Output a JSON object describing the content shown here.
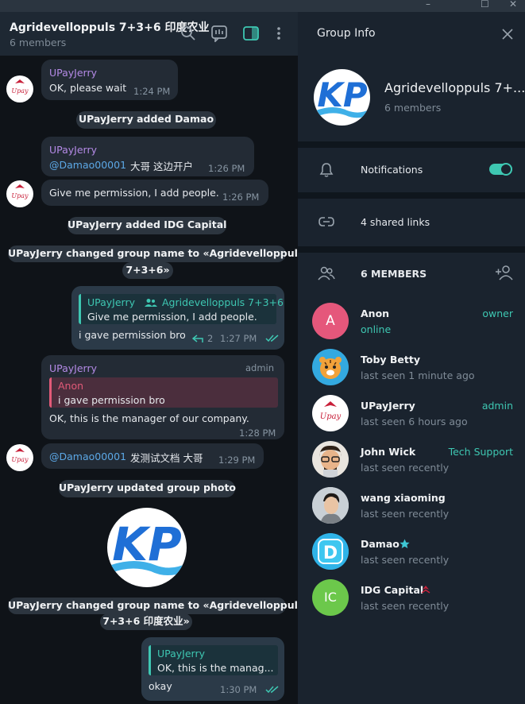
{
  "window": {
    "minimize": "–",
    "maximize": "☐",
    "close": "✕"
  },
  "chat": {
    "title": "Agridevelloppuls 7+3+6 印度农业",
    "subtitle": "6 members",
    "header_icons": [
      "search-icon",
      "poll-icon",
      "sidebar-toggle-icon",
      "more-icon"
    ],
    "messages": {
      "m1": {
        "sender": "UPayJerry",
        "text": "OK, please wait",
        "time": "1:24 PM"
      },
      "s1": "UPayJerry added Damao",
      "m2": {
        "sender": "UPayJerry",
        "mention": "@Damao00001",
        "text": "大哥  这边开户",
        "time": "1:26 PM"
      },
      "m3": {
        "text": "Give me permission, I add people.",
        "time": "1:26 PM"
      },
      "s2": "UPayJerry added IDG Capital",
      "s3_line1": "UPayJerry changed group name to «Agridevelloppuls",
      "s3_line2": "7+3+6»",
      "m4": {
        "reply_sender": "UPayJerry",
        "reply_group": "Agridevelloppuls 7+3+6",
        "reply_text": "Give me permission, I add people.",
        "text": "i gave permission bro",
        "replies": "2",
        "time": "1:27 PM"
      },
      "m5": {
        "sender": "UPayJerry",
        "badge": "admin",
        "reply_sender": "Anon",
        "reply_text": "i gave permission bro",
        "text": "OK, this is the manager of our company.",
        "time": "1:28 PM"
      },
      "m6": {
        "mention": "@Damao00001",
        "text": "发测试文档  大哥",
        "time": "1:29 PM"
      },
      "s4": "UPayJerry updated group photo",
      "s5_line1": "UPayJerry changed group name to «Agridevelloppuls",
      "s5_line2": "7+3+6 印度农业»",
      "m7": {
        "reply_sender": "UPayJerry",
        "reply_text": "OK, this is the manag...",
        "text": "okay",
        "time": "1:30 PM"
      }
    }
  },
  "group_info": {
    "title": "Group Info",
    "name": "Agridevelloppuls 7+...",
    "members_count": "6 members",
    "notifications_label": "Notifications",
    "notifications_on": true,
    "shared_links": "4 shared links",
    "members_header": "6 MEMBERS",
    "members": [
      {
        "name": "Anon",
        "status": "online",
        "role": "owner",
        "initial": "A",
        "color": "#e5577b"
      },
      {
        "name": "Toby Betty",
        "status": "last seen 1 minute ago",
        "role": "",
        "avatar": "tiger-avatar"
      },
      {
        "name": "UPayJerry",
        "status": "last seen 6 hours ago",
        "role": "admin",
        "avatar": "upay-logo"
      },
      {
        "name": "John Wick",
        "status": "last seen recently",
        "role": "Tech Support",
        "avatar": "memoji-avatar"
      },
      {
        "name": "wang xiaoming",
        "status": "last seen recently",
        "role": "",
        "avatar": "photo-avatar"
      },
      {
        "name": "Damao",
        "status": "last seen recently",
        "role": "",
        "avatar": "d-avatar",
        "badge": "star-icon"
      },
      {
        "name": "IDG Capital",
        "status": "last seen recently",
        "role": "",
        "initial": "IC",
        "color": "#6cc84b",
        "badge": "upay-badge-icon"
      }
    ]
  },
  "colors": {
    "accent": "#3ec7b2",
    "sender": "#b48ae6",
    "mention": "#5ca8e6",
    "reply_red": "#e25a78"
  }
}
